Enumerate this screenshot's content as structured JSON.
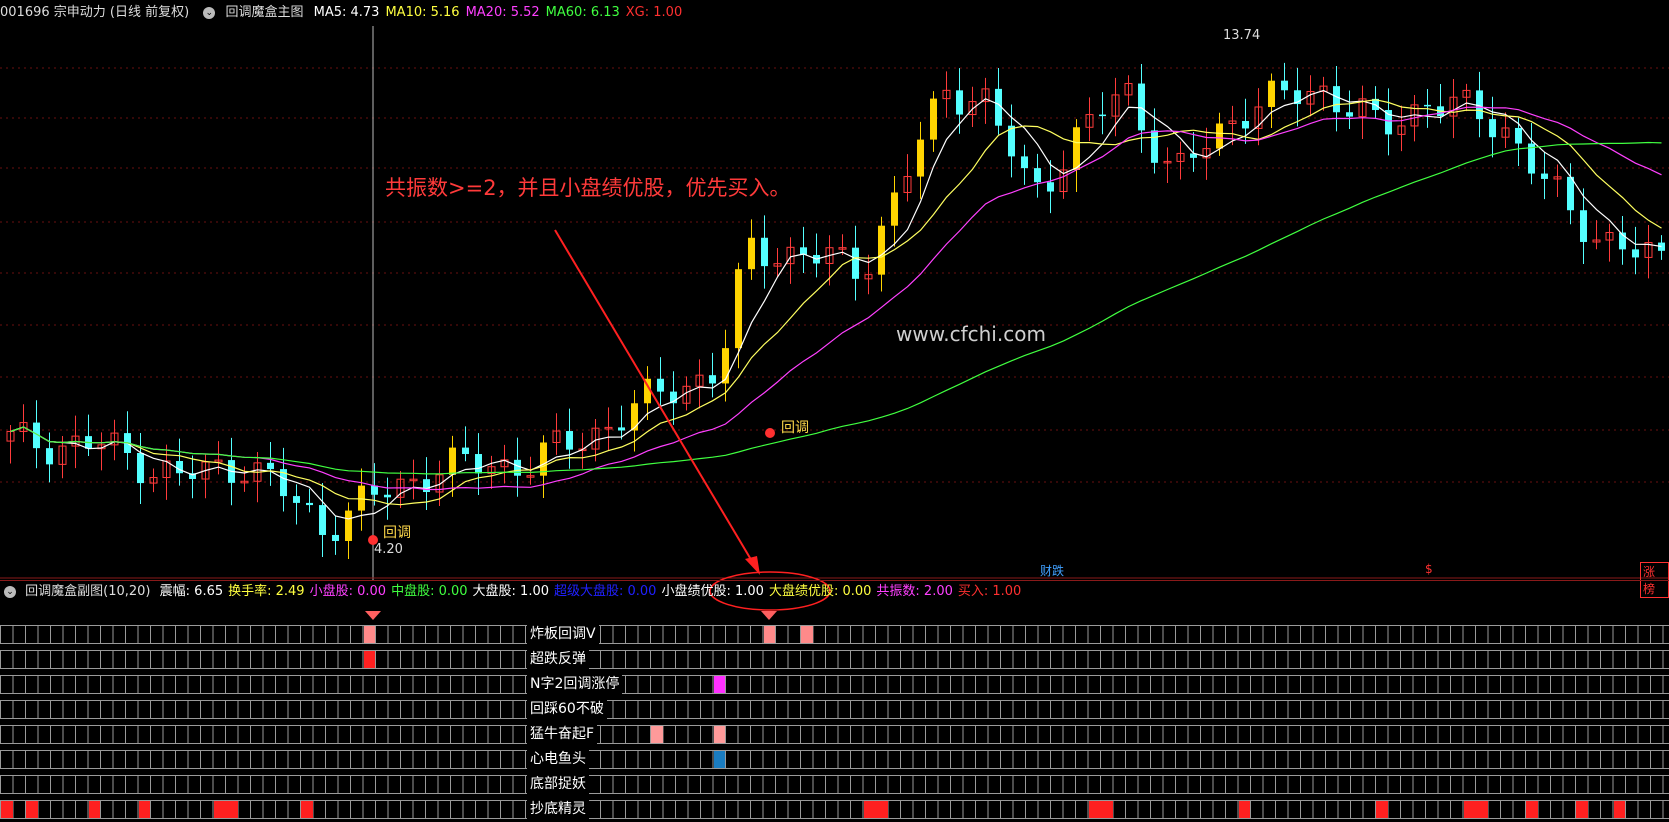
{
  "main_header": {
    "stock": "001696 宗申动力 (日线 前复权)",
    "indicator": "回调魔盒主图",
    "items": [
      {
        "label": "MA5:",
        "value": "4.73",
        "color": "#ffffff"
      },
      {
        "label": "MA10:",
        "value": "5.16",
        "color": "#ffff40"
      },
      {
        "label": "MA20:",
        "value": "5.52",
        "color": "#ff40ff"
      },
      {
        "label": "MA60:",
        "value": "6.13",
        "color": "#40ff40"
      },
      {
        "label": "XG:",
        "value": "1.00",
        "color": "#ff3030"
      }
    ]
  },
  "annotation": "共振数>=2，并且小盘绩优股，优先买入。",
  "watermark": "www.cfchi.com",
  "price_labels": {
    "high": "13.74",
    "low": "4.20"
  },
  "signal_labels": {
    "pullback_1": "回调",
    "pullback_2": "回调"
  },
  "event_flags": [
    {
      "text": "财跌",
      "color": "#40a0ff"
    },
    {
      "text": "$",
      "color": "#ff3030"
    },
    {
      "text": "涨榜",
      "color": "#ff3030"
    }
  ],
  "sub_header": {
    "indicator": "回调魔盒副图(10,20)",
    "items": [
      {
        "label": "震幅:",
        "value": "6.65",
        "color": "#ffffff"
      },
      {
        "label": "换手率:",
        "value": "2.49",
        "color": "#ffff40"
      },
      {
        "label": "小盘股:",
        "value": "0.00",
        "color": "#ff40ff"
      },
      {
        "label": "中盘股:",
        "value": "0.00",
        "color": "#40ff40"
      },
      {
        "label": "大盘股:",
        "value": "1.00",
        "color": "#ffffff"
      },
      {
        "label": "超级大盘股:",
        "value": "0.00",
        "color": "#2020ff"
      },
      {
        "label": "小盘绩优股:",
        "value": "1.00",
        "color": "#ffffff"
      },
      {
        "label": "大盘绩优股:",
        "value": "0.00",
        "color": "#ffff40"
      },
      {
        "label": "共振数:",
        "value": "2.00",
        "color": "#ff40ff"
      },
      {
        "label": "买入:",
        "value": "1.00",
        "color": "#ff3030"
      }
    ]
  },
  "signal_rows": [
    {
      "label": "炸板回调V"
    },
    {
      "label": "超跌反弹"
    },
    {
      "label": "N字2回调涨停"
    },
    {
      "label": "回踩60不破"
    },
    {
      "label": "猛牛奋起F"
    },
    {
      "label": "心电鱼头"
    },
    {
      "label": "底部捉妖"
    },
    {
      "label": "抄底精灵"
    }
  ],
  "colors": {
    "up": "#ff3b3b",
    "down": "#54ffff",
    "limit": "#ffd400",
    "grid": "#8a1a1a"
  }
}
